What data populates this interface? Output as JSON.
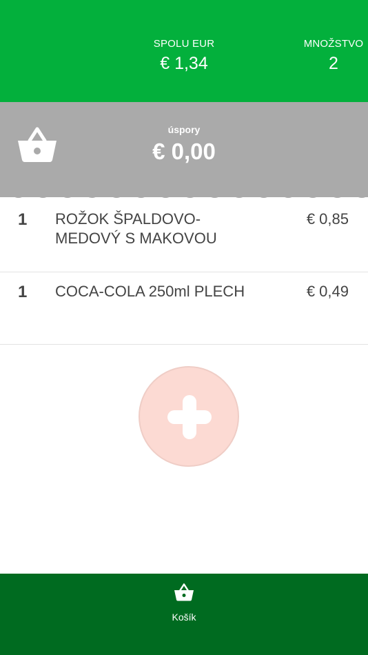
{
  "header": {
    "total_label": "SPOLU EUR",
    "total_value": "€ 1,34",
    "qty_label": "MNOŽSTVO",
    "qty_value": "2",
    "color": "#03b03c"
  },
  "savings": {
    "label": "úspory",
    "value": "€ 0,00",
    "icon": "basket-icon",
    "color": "#aaaaaa"
  },
  "items": [
    {
      "qty": "1",
      "name": "ROŽOK ŠPALDOVO-MEDOVÝ S MAKOVOU",
      "price": "€ 0,85"
    },
    {
      "qty": "1",
      "name": "COCA-COLA 250ml PLECH",
      "price": "€ 0,49"
    }
  ],
  "add_button": {
    "icon": "plus-icon",
    "color": "#fcdad3"
  },
  "bottom_nav": {
    "items": [
      {
        "label": "Košík",
        "icon": "basket-icon"
      }
    ],
    "color": "#006b20"
  }
}
